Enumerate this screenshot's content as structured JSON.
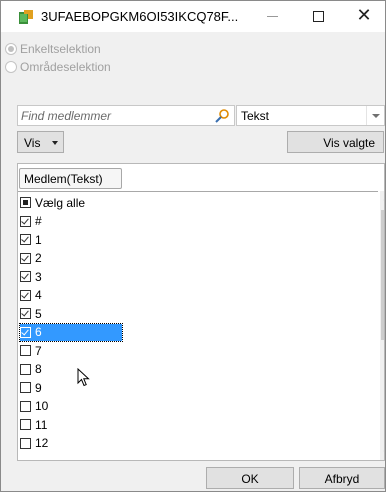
{
  "window": {
    "title": "3UFAEBOPGKM6OI53IKCQ78F..."
  },
  "selection_mode": {
    "options": [
      "Enkeltselektion",
      "Områdeselektion"
    ],
    "selected": "Enkeltselektion"
  },
  "search": {
    "placeholder": "Find medlemmer",
    "value": ""
  },
  "type_select": {
    "value": "Tekst"
  },
  "toolbar": {
    "vis_label": "Vis",
    "vis_valgte_label": "Vis valgte"
  },
  "list": {
    "column_header": "Medlem(Tekst)",
    "items": [
      {
        "label": "Vælg alle",
        "state": "partial",
        "selected": false
      },
      {
        "label": "#",
        "state": "checked",
        "selected": false
      },
      {
        "label": "1",
        "state": "checked",
        "selected": false
      },
      {
        "label": "2",
        "state": "checked",
        "selected": false
      },
      {
        "label": "3",
        "state": "checked",
        "selected": false
      },
      {
        "label": "4",
        "state": "checked",
        "selected": false
      },
      {
        "label": "5",
        "state": "checked",
        "selected": false
      },
      {
        "label": "6",
        "state": "checked",
        "selected": true
      },
      {
        "label": "7",
        "state": "unchecked",
        "selected": false
      },
      {
        "label": "8",
        "state": "unchecked",
        "selected": false
      },
      {
        "label": "9",
        "state": "unchecked",
        "selected": false
      },
      {
        "label": "10",
        "state": "unchecked",
        "selected": false
      },
      {
        "label": "11",
        "state": "unchecked",
        "selected": false
      },
      {
        "label": "12",
        "state": "unchecked",
        "selected": false
      }
    ]
  },
  "footer": {
    "ok_label": "OK",
    "cancel_label": "Afbryd"
  },
  "colors": {
    "selection": "#3399ff",
    "app_icon": "#e0a020"
  }
}
